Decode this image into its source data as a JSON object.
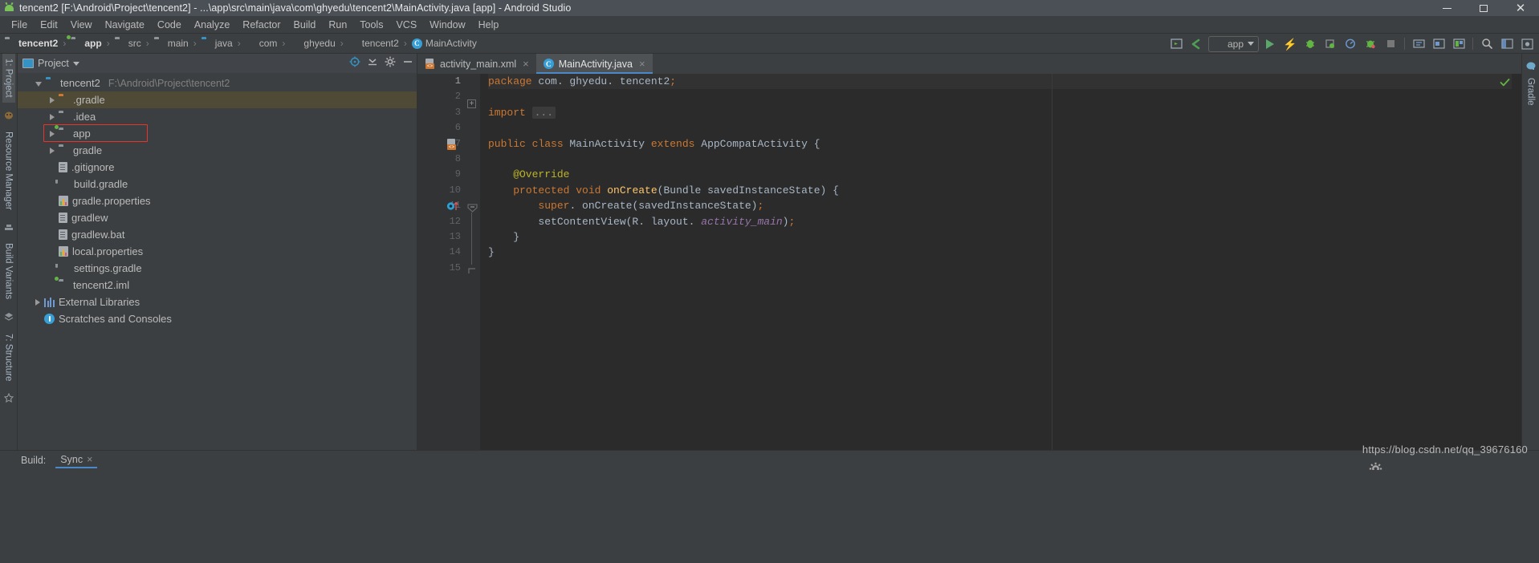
{
  "window": {
    "title": "tencent2 [F:\\Android\\Project\\tencent2] - ...\\app\\src\\main\\java\\com\\ghyedu\\tencent2\\MainActivity.java [app] - Android Studio",
    "app_icon": "android-droid-icon",
    "controls": {
      "minimize": "–",
      "maximize": "□",
      "close": "✕"
    }
  },
  "menubar": {
    "items": [
      {
        "label": "File"
      },
      {
        "label": "Edit"
      },
      {
        "label": "View"
      },
      {
        "label": "Navigate"
      },
      {
        "label": "Code"
      },
      {
        "label": "Analyze"
      },
      {
        "label": "Refactor"
      },
      {
        "label": "Build"
      },
      {
        "label": "Run"
      },
      {
        "label": "Tools"
      },
      {
        "label": "VCS"
      },
      {
        "label": "Window"
      },
      {
        "label": "Help"
      }
    ]
  },
  "breadcrumb": {
    "items": [
      {
        "label": "tencent2",
        "icon": "folder-icon",
        "bold": true
      },
      {
        "label": "app",
        "icon": "module-folder-icon",
        "bold": true
      },
      {
        "label": "src",
        "icon": "folder-icon",
        "bold": false
      },
      {
        "label": "main",
        "icon": "folder-icon",
        "bold": false
      },
      {
        "label": "java",
        "icon": "source-folder-icon",
        "bold": false
      },
      {
        "label": "com",
        "icon": "package-icon",
        "bold": false
      },
      {
        "label": "ghyedu",
        "icon": "package-icon",
        "bold": false
      },
      {
        "label": "tencent2",
        "icon": "package-icon",
        "bold": false
      },
      {
        "label": "MainActivity",
        "icon": "class-icon",
        "bold": false
      }
    ],
    "separator": "›"
  },
  "toolbar": {
    "run_config_label": "app",
    "run_config_icon": "android-bug-icon",
    "dropdown_icon": "chevron-down-icon",
    "buttons": [
      {
        "name": "layout-inspector-icon"
      },
      {
        "name": "sync-gradle-icon"
      },
      {
        "name": "run-icon"
      },
      {
        "name": "apply-changes-icon"
      },
      {
        "name": "debug-icon"
      },
      {
        "name": "attach-debugger-icon"
      },
      {
        "name": "profiler-icon"
      },
      {
        "name": "avd-manager-icon"
      },
      {
        "name": "stop-icon"
      },
      {
        "name": "sdk-manager-icon"
      },
      {
        "name": "device-file-explorer-icon"
      },
      {
        "name": "layout-editor-icon"
      },
      {
        "name": "search-icon"
      },
      {
        "name": "project-structure-icon"
      },
      {
        "name": "settings-icon"
      }
    ]
  },
  "left_strip": {
    "tabs": [
      {
        "label": "1: Project",
        "active": true
      },
      {
        "label": "Resource Manager",
        "active": false
      },
      {
        "label": "Build Variants",
        "active": false
      },
      {
        "label": "7: Structure",
        "active": false
      }
    ]
  },
  "right_strip": {
    "tabs": [
      {
        "label": "Gradle",
        "active": false
      }
    ]
  },
  "project_panel": {
    "title": "Project",
    "title_icon": "project-view-icon",
    "dropdown_icon": "chevron-down-icon",
    "tools": [
      {
        "name": "locate-file-icon"
      },
      {
        "name": "collapse-all-icon"
      },
      {
        "name": "settings-gear-icon"
      },
      {
        "name": "hide-panel-icon"
      }
    ],
    "tree": [
      {
        "label": "tencent2",
        "path": "F:\\Android\\Project\\tencent2",
        "icon": "project-root-icon",
        "arrow": "open",
        "depth": 0,
        "selected": false,
        "highlight": false
      },
      {
        "label": ".gradle",
        "path": "",
        "icon": "folder-orange-icon",
        "arrow": "closed",
        "depth": 1,
        "selected": true,
        "highlight": false
      },
      {
        "label": ".idea",
        "path": "",
        "icon": "folder-icon",
        "arrow": "closed",
        "depth": 1,
        "selected": false,
        "highlight": false
      },
      {
        "label": "app",
        "path": "",
        "icon": "module-folder-icon",
        "arrow": "closed",
        "depth": 1,
        "selected": false,
        "highlight": true
      },
      {
        "label": "gradle",
        "path": "",
        "icon": "folder-icon",
        "arrow": "closed",
        "depth": 1,
        "selected": false,
        "highlight": false
      },
      {
        "label": ".gitignore",
        "path": "",
        "icon": "file-icon",
        "arrow": "none",
        "depth": 1,
        "selected": false,
        "highlight": false
      },
      {
        "label": "build.gradle",
        "path": "",
        "icon": "gradle-icon",
        "arrow": "none",
        "depth": 1,
        "selected": false,
        "highlight": false
      },
      {
        "label": "gradle.properties",
        "path": "",
        "icon": "properties-icon",
        "arrow": "none",
        "depth": 1,
        "selected": false,
        "highlight": false
      },
      {
        "label": "gradlew",
        "path": "",
        "icon": "file-icon",
        "arrow": "none",
        "depth": 1,
        "selected": false,
        "highlight": false
      },
      {
        "label": "gradlew.bat",
        "path": "",
        "icon": "file-icon",
        "arrow": "none",
        "depth": 1,
        "selected": false,
        "highlight": false
      },
      {
        "label": "local.properties",
        "path": "",
        "icon": "properties-icon",
        "arrow": "none",
        "depth": 1,
        "selected": false,
        "highlight": false
      },
      {
        "label": "settings.gradle",
        "path": "",
        "icon": "gradle-icon",
        "arrow": "none",
        "depth": 1,
        "selected": false,
        "highlight": false
      },
      {
        "label": "tencent2.iml",
        "path": "",
        "icon": "module-file-icon",
        "arrow": "none",
        "depth": 1,
        "selected": false,
        "highlight": false
      },
      {
        "label": "External Libraries",
        "path": "",
        "icon": "libraries-icon",
        "arrow": "closed",
        "depth": 0,
        "selected": false,
        "highlight": false
      },
      {
        "label": "Scratches and Consoles",
        "path": "",
        "icon": "scratches-icon",
        "arrow": "none",
        "depth": 0,
        "selected": false,
        "highlight": false
      }
    ]
  },
  "editor": {
    "tabs": [
      {
        "label": "activity_main.xml",
        "icon": "xml-layout-icon",
        "active": false,
        "close_icon": "×"
      },
      {
        "label": "MainActivity.java",
        "icon": "java-class-icon",
        "active": true,
        "close_icon": "×"
      }
    ],
    "inspection_status_icon": "check-ok-icon",
    "lines": [
      {
        "num": "1",
        "current": true,
        "gutter_icon": "",
        "fold": "",
        "tokens": [
          {
            "t": "package ",
            "c": "kw"
          },
          {
            "t": "com. ghyedu. tencent2",
            "c": "pun"
          },
          {
            "t": ";",
            "c": "kw"
          }
        ]
      },
      {
        "num": "2",
        "current": false,
        "gutter_icon": "",
        "fold": "",
        "tokens": []
      },
      {
        "num": "3",
        "current": false,
        "gutter_icon": "",
        "fold": "plus",
        "tokens": [
          {
            "t": "import ",
            "c": "kw"
          },
          {
            "t": "...",
            "c": "fold"
          }
        ]
      },
      {
        "num": "6",
        "current": false,
        "gutter_icon": "",
        "fold": "",
        "tokens": []
      },
      {
        "num": "7",
        "current": false,
        "gutter_icon": "xml-layout-icon",
        "fold": "",
        "tokens": [
          {
            "t": "public class ",
            "c": "kw"
          },
          {
            "t": "MainActivity ",
            "c": "pun"
          },
          {
            "t": "extends ",
            "c": "kw"
          },
          {
            "t": "AppCompatActivity {",
            "c": "pun"
          }
        ]
      },
      {
        "num": "8",
        "current": false,
        "gutter_icon": "",
        "fold": "",
        "tokens": []
      },
      {
        "num": "9",
        "current": false,
        "gutter_icon": "",
        "fold": "",
        "tokens": [
          {
            "t": "    @Override",
            "c": "ann"
          }
        ]
      },
      {
        "num": "10",
        "current": false,
        "gutter_icon": "override-method-icon",
        "fold": "minus",
        "tokens": [
          {
            "t": "    ",
            "c": "pun"
          },
          {
            "t": "protected void ",
            "c": "kw"
          },
          {
            "t": "onCreate",
            "c": "mth"
          },
          {
            "t": "(Bundle savedInstanceState) {",
            "c": "pun"
          }
        ]
      },
      {
        "num": "11",
        "current": false,
        "gutter_icon": "",
        "fold": "",
        "tokens": [
          {
            "t": "        ",
            "c": "pun"
          },
          {
            "t": "super",
            "c": "kw"
          },
          {
            "t": ". onCreate(savedInstanceState)",
            "c": "pun"
          },
          {
            "t": ";",
            "c": "kw"
          }
        ]
      },
      {
        "num": "12",
        "current": false,
        "gutter_icon": "",
        "fold": "",
        "tokens": [
          {
            "t": "        setContentView(R. layout. ",
            "c": "pun"
          },
          {
            "t": "activity_main",
            "c": "fld"
          },
          {
            "t": ")",
            "c": "pun"
          },
          {
            "t": ";",
            "c": "kw"
          }
        ]
      },
      {
        "num": "13",
        "current": false,
        "gutter_icon": "",
        "fold": "end",
        "tokens": [
          {
            "t": "    }",
            "c": "pun"
          }
        ]
      },
      {
        "num": "14",
        "current": false,
        "gutter_icon": "",
        "fold": "",
        "tokens": [
          {
            "t": "}",
            "c": "pun"
          }
        ]
      },
      {
        "num": "15",
        "current": false,
        "gutter_icon": "",
        "fold": "",
        "tokens": []
      }
    ]
  },
  "bottom": {
    "build_label": "Build:",
    "sync_tab_label": "Sync",
    "sync_close_icon": "×",
    "sync_status_icon": "gradle-sync-icon"
  },
  "watermark": {
    "text": "https://blog.csdn.net/qq_39676160"
  },
  "colors": {
    "accent_blue": "#4a88c7",
    "green": "#62b543",
    "orange": "#cc7832",
    "highlight_red": "#e8342a",
    "editor_bg": "#2b2b2b",
    "chrome_bg": "#3c3f41",
    "selected_row": "#4e4a36"
  }
}
